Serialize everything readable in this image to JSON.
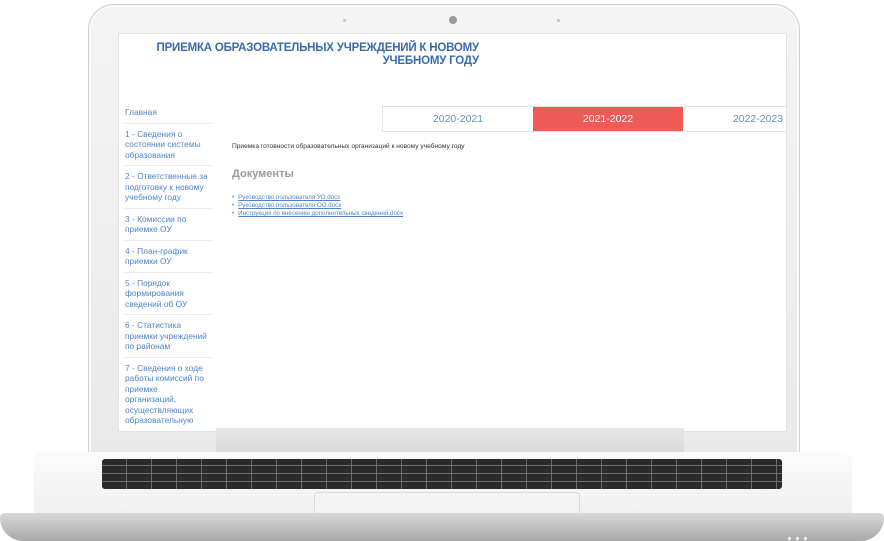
{
  "site": {
    "title": "ПРИЕМКА ОБРАЗОВАТЕЛЬНЫХ УЧРЕЖДЕНИЙ К НОВОМУ УЧЕБНОМУ ГОДУ"
  },
  "sidebar": {
    "items": [
      {
        "label": "Главная"
      },
      {
        "label": "1 - Сведения о состоянии системы образования"
      },
      {
        "label": "2 - Ответственные за подготовку к новому учебному году"
      },
      {
        "label": "3 - Комиссии по приемке ОУ"
      },
      {
        "label": "4 - План-график приемки ОУ"
      },
      {
        "label": "5 - Порядок формирования сведений об ОУ"
      },
      {
        "label": "6 - Статистика приемки учреждений по районам"
      },
      {
        "label": "7 - Сведения о ходе работы комиссий по приемке организаций, осуществляющих образовательную"
      }
    ]
  },
  "tabs": [
    {
      "label": "2020-2021",
      "active": false
    },
    {
      "label": "2021-2022",
      "active": true
    },
    {
      "label": "2022-2023",
      "active": false
    }
  ],
  "main": {
    "heading": "Приемка готовности образовательных организаций к новому учебному году",
    "documents_title": "Документы",
    "documents": [
      {
        "label": "Руководство пользователя УО.docx"
      },
      {
        "label": "Руководство пользователя ОО.docx"
      },
      {
        "label": "Инструкция по внесению дополнительных сведений.docx"
      }
    ]
  },
  "colors": {
    "accent_active_tab": "#ee5a56",
    "link": "#4f86c6",
    "title": "#3a6aa8"
  },
  "icons": [
    "camera-icon"
  ]
}
